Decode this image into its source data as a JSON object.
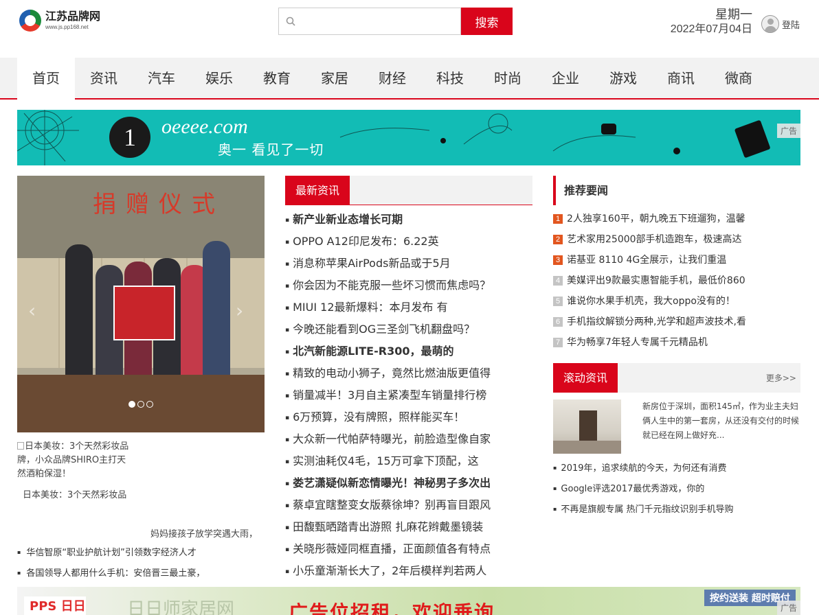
{
  "header": {
    "logo_title": "江苏品牌网",
    "logo_url": "www.js.pp168.net",
    "search_button": "搜索",
    "search_placeholder": "",
    "weekday": "星期一",
    "date": "2022年07月04日",
    "login": "登陆"
  },
  "nav": [
    "首页",
    "资讯",
    "汽车",
    "娱乐",
    "教育",
    "家居",
    "财经",
    "科技",
    "时尚",
    "企业",
    "游戏",
    "商讯",
    "微商"
  ],
  "ad_top": {
    "number": "1",
    "brand": "oeeee.com",
    "slogan": "奥一 看见了一切",
    "tag": "广告"
  },
  "slideshow": {
    "sign": "捐赠仪式",
    "prev_arrow": "‹",
    "next_arrow": "›",
    "alt_text": "日本美妆：3个天然彩妆品牌，小众品牌SHIRO主打天然酒粕保湿！",
    "caption": "日本美妆：3个天然彩妆品",
    "slide_index": 1,
    "slide_count": 3
  },
  "left_news": {
    "right_text": "妈妈接孩子放学突遇大雨，",
    "items": [
      "华信智原“职业护航计划”引领数字经济人才",
      "各国领导人都用什么手机：安倍晋三最土豪，"
    ]
  },
  "latest": {
    "title": "最新资讯",
    "items": [
      {
        "text": "新产业新业态增长可期",
        "bold": true
      },
      {
        "text": "OPPO A12印尼发布：6.22英",
        "bold": false
      },
      {
        "text": "消息称苹果AirPods新品或于5月",
        "bold": false
      },
      {
        "text": "你会因为不能克服一些坏习惯而焦虑吗？",
        "bold": false
      },
      {
        "text": "MIUI 12最新爆料：本月发布 有",
        "bold": false
      },
      {
        "text": "今晚还能看到OG三圣剑飞机翻盘吗？",
        "bold": false
      },
      {
        "text": "北汽新能源LITE-R300，最萌的",
        "bold": true
      },
      {
        "text": "精致的电动小狮子，竟然比燃油版更值得",
        "bold": false
      },
      {
        "text": "销量减半！3月自主紧凑型车销量排行榜",
        "bold": false
      },
      {
        "text": "6万预算，没有牌照，照样能买车！",
        "bold": false
      },
      {
        "text": "大众新一代帕萨特曝光，前脸造型像自家",
        "bold": false
      },
      {
        "text": "实测油耗仅4毛，15万可拿下顶配，这",
        "bold": false
      },
      {
        "text": "娄艺潇疑似新恋情曝光！神秘男子多次出",
        "bold": true
      },
      {
        "text": "蔡卓宜瞎整变女版蔡徐坤？别再盲目跟风",
        "bold": false
      },
      {
        "text": "田馥甄晒踏青出游照 扎麻花辫戴墨镜装",
        "bold": false
      },
      {
        "text": "关晓彤薇娅同框直播，正面颜值各有特点",
        "bold": false
      },
      {
        "text": "小乐童渐渐长大了，2年后模样判若两人",
        "bold": false
      }
    ]
  },
  "recommend": {
    "title": "推荐要闻",
    "items": [
      {
        "num": "1",
        "text": "2人独享160平，朝九晚五下班遛狗，温馨",
        "color": "#e2561f"
      },
      {
        "num": "2",
        "text": "艺术家用25000部手机造跑车，极速高达",
        "color": "#e2561f"
      },
      {
        "num": "3",
        "text": "诺基亚 8110 4G全展示，让我们重温",
        "color": "#e2561f"
      },
      {
        "num": "4",
        "text": "美媒评出9款最实惠智能手机，最低价860",
        "color": "#c4c4c4"
      },
      {
        "num": "5",
        "text": "谁说你水果手机壳，我大oppo没有的！",
        "color": "#c4c4c4"
      },
      {
        "num": "6",
        "text": "手机指纹解锁分两种,光学和超声波技术,看",
        "color": "#c4c4c4"
      },
      {
        "num": "7",
        "text": "华为畅享7年轻人专属千元精品机",
        "color": "#c4c4c4"
      }
    ]
  },
  "rolling": {
    "title": "滚动资讯",
    "more": "更多>>",
    "summary": "新房位于深圳，面积145㎡，作为业主夫妇俩人生中的第一套房，从还没有交付的时候就已经在网上做好充...",
    "items": [
      "2019年，追求续航的今天，为何还有消费",
      "Google评选2017最优秀游戏，你的",
      "不再是旗舰专属 热门千元指纹识别手机导购"
    ]
  },
  "ad_bottom": {
    "logo": "PPS 日日",
    "t1": "日日师家居网",
    "t2": "广告位招租，欢迎垂询",
    "t3": "按约送装 超时赔付",
    "tag": "广告"
  }
}
